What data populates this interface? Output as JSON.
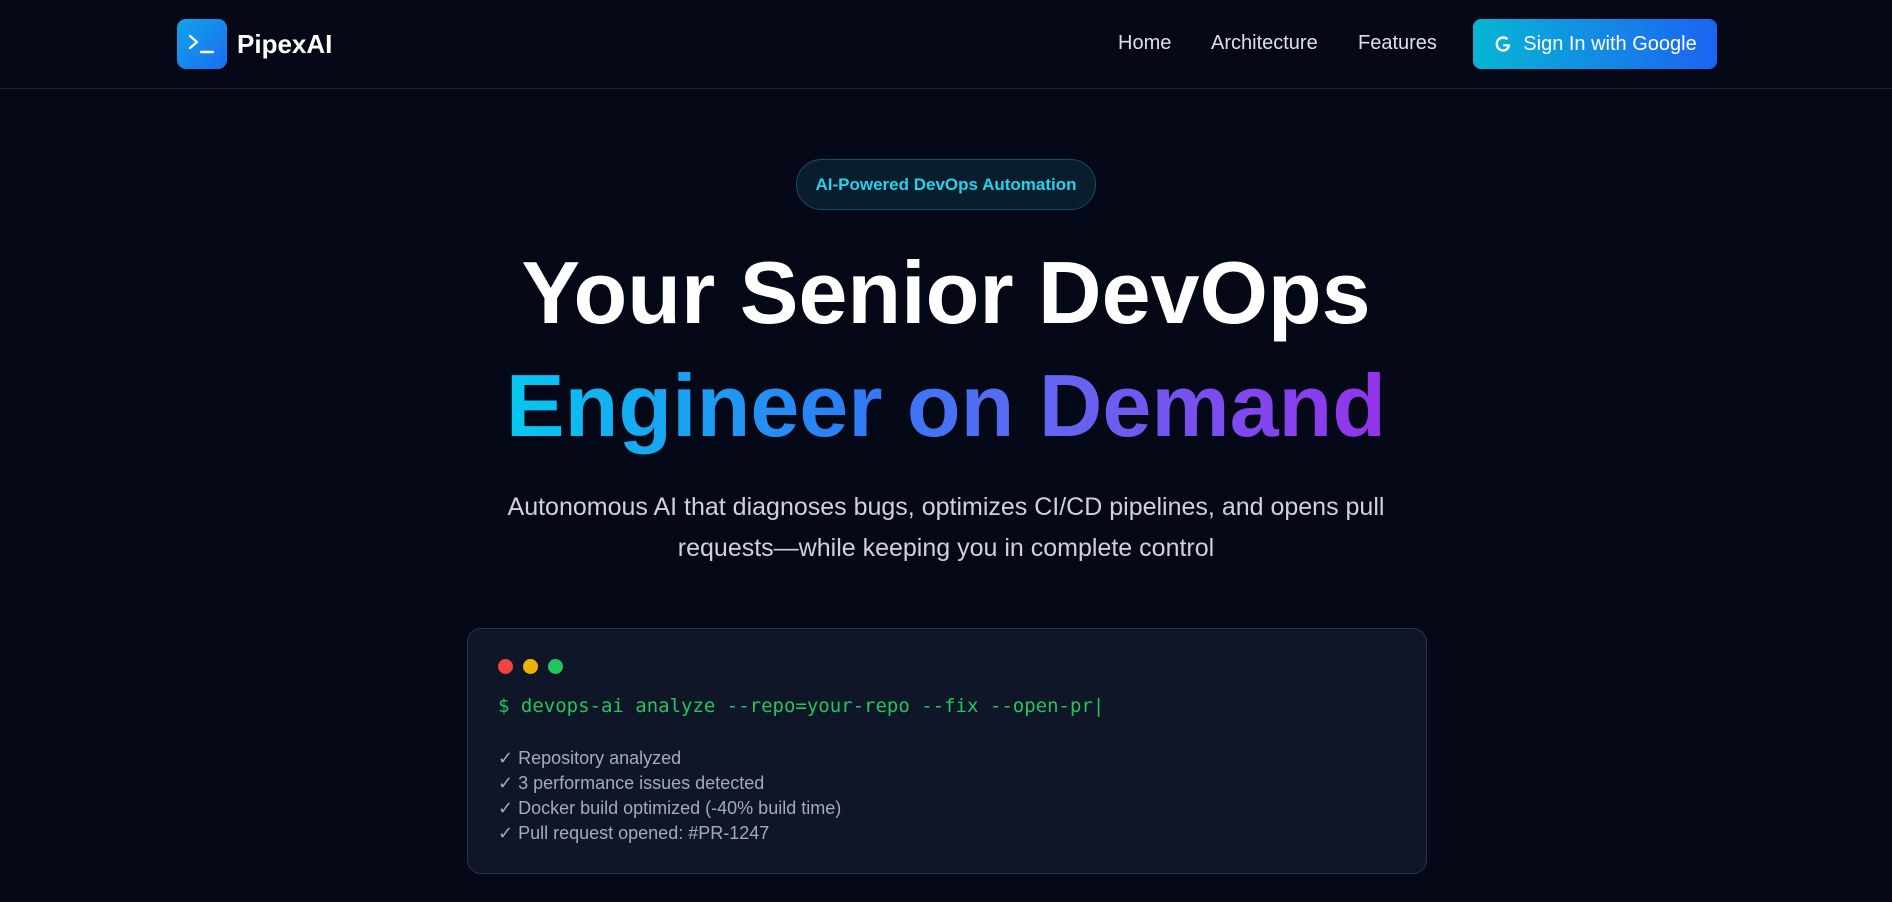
{
  "brand": {
    "name": "PipexAI",
    "logo_icon": "terminal-prompt-icon"
  },
  "nav": {
    "items": [
      {
        "label": "Home"
      },
      {
        "label": "Architecture"
      },
      {
        "label": "Features"
      }
    ],
    "signin_label": "Sign In with Google",
    "signin_icon": "google-icon"
  },
  "hero": {
    "badge": "AI-Powered DevOps Automation",
    "title_line1": "Your Senior DevOps",
    "title_line2": "Engineer on Demand",
    "subtitle": "Autonomous AI that diagnoses bugs, optimizes CI/CD pipelines, and opens pull requests—while keeping you in complete control"
  },
  "terminal": {
    "command": "$ devops-ai analyze --repo=your-repo --fix --open-pr|",
    "output": [
      "✓ Repository analyzed",
      "✓ 3 performance issues detected",
      "✓ Docker build optimized (-40% build time)",
      "✓ Pull request opened: #PR-1247"
    ]
  },
  "colors": {
    "background": "#050816",
    "accent_cyan": "#06b6d4",
    "accent_blue": "#1d63f3",
    "accent_purple": "#9333ea",
    "terminal_green": "#22c55e"
  }
}
